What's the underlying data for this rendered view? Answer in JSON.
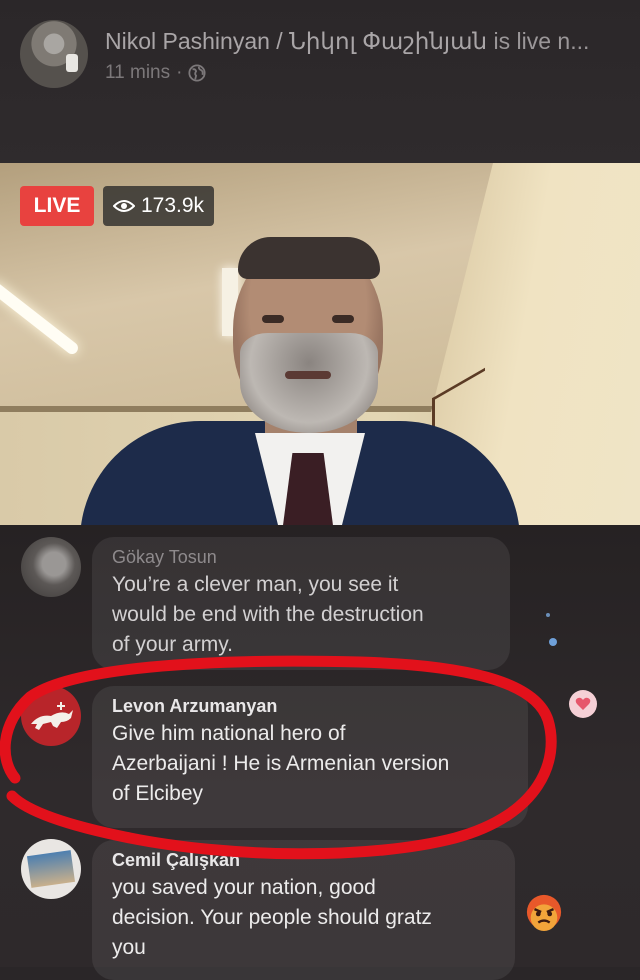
{
  "header": {
    "host_name": "Nikol Pashinyan / Նիկոլ Փաշինյան",
    "status_suffix": "is live n...",
    "time_ago": "11 mins",
    "separator": "·",
    "audience_icon": "globe-icon"
  },
  "video": {
    "live_label": "LIVE",
    "viewer_count": "173.9k",
    "viewer_icon": "eye-icon"
  },
  "comments": [
    {
      "author": "Gökay Tosun",
      "text_lines": [
        "You’re a clever man, you see it",
        "would be end with the destruction",
        "of your army."
      ]
    },
    {
      "author": "Levon Arzumanyan",
      "text_lines": [
        "Give him national hero of",
        "Azerbaijani ! He is Armenian version",
        "of Elcibey"
      ]
    },
    {
      "author": "Cemil Çalışkan",
      "text_lines": [
        "you saved your nation, good",
        "decision. Your people should gratz",
        "you"
      ]
    }
  ],
  "reactions": {
    "heart": "heart-icon",
    "angry": "angry-icon"
  },
  "colors": {
    "live_red": "#e8423f",
    "annotation_red": "#e2111b",
    "background": "#2a2628"
  }
}
